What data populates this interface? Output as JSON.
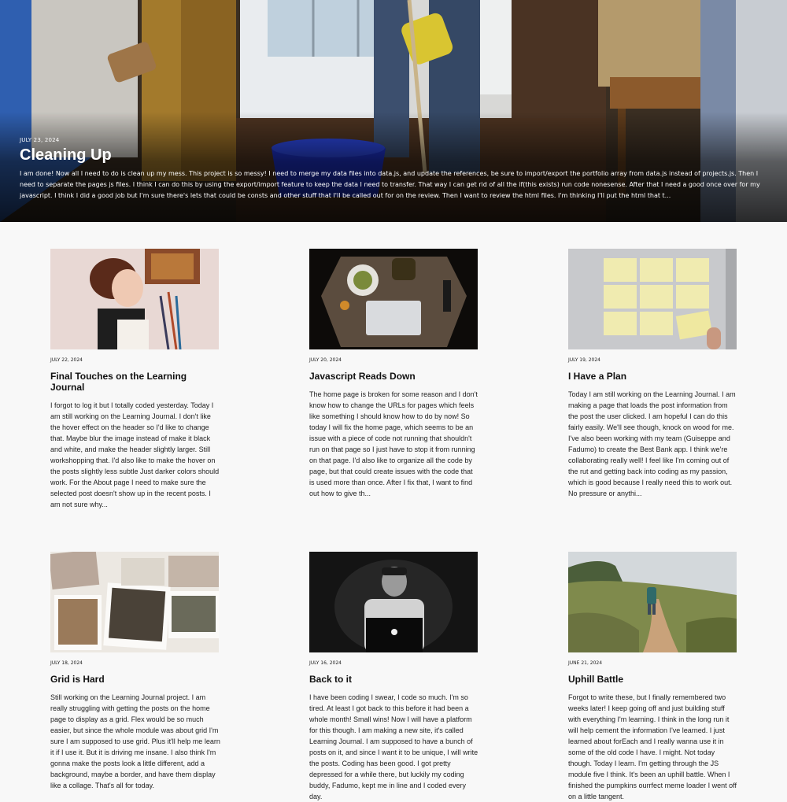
{
  "hero": {
    "date": "JULY 23, 2024",
    "title": "Cleaning Up",
    "excerpt": "I am done! Now all I need to do is clean up my mess. This project is so messy! I need to merge my data files into data.js, and update the references, be sure to import/export the portfolio array from data.js instead of projects.js. Then I need to separate the pages js files. I think I can do this by using the export/import feature to keep the data I need to transfer. That way I can get rid of all the if(this exists) run code nonesense. After that I need a good once over for my javascript. I think I did a good job but I'm sure there's lets that could be consts and other stuff that I'll be called out for on the review. Then I want to review the html files. I'm thinking I'll put the html that t..."
  },
  "posts": [
    {
      "date": "JULY 22, 2024",
      "title": "Final Touches on the Learning Journal",
      "excerpt": "I forgot to log it but I totally coded yesterday. Today I am still working on the Learning Journal. I don't like the hover effect on the header so I'd like to change that. Maybe blur the image instead of make it black and white, and make the header slightly larger. Still workshopping that. I'd also like to make the hover on the posts slightly less subtle Just darker colors should work. For the About page I need to make sure the selected post doesn't show up in the recent posts. I am not sure why..."
    },
    {
      "date": "JULY 20, 2024",
      "title": "Javascript Reads Down",
      "excerpt": "The home page is broken for some reason and I don't know how to change the URLs for pages which feels like something I should know how to do by now! So today I will fix the home page, which seems to be an issue with a piece of code not running that shouldn't run on that page so I just have to stop it from running on that page. I'd also like to organize all the code by page, but that could create issues with the code that is used more than once. After I fix that, I want to find out how to give th..."
    },
    {
      "date": "JULY 19, 2024",
      "title": "I Have a Plan",
      "excerpt": "Today I am still working on the Learning Journal. I am making a page that loads the post information from the post the user clicked. I am hopeful I can do this fairly easily. We'll see though, knock on wood for me. I've also been working with my team (Guiseppe and Fadumo) to create the Best Bank app. I think we're collaborating really well! I feel like I'm coming out of the rut and getting back into coding as my passion, which is good because I really need this to work out. No pressure or anythi..."
    },
    {
      "date": "JULY 18, 2024",
      "title": "Grid is Hard",
      "excerpt": "Still working on the Learning Journal project. I am really struggling with getting the posts on the home page to display as a grid. Flex would be so much easier, but since the whole module was about grid I'm sure I am supposed to use grid. Plus it'll help me learn it if I use it. But it is driving me insane. I also think I'm gonna make the posts look a little different, add a background, maybe a border, and have them display like a collage. That's all for today."
    },
    {
      "date": "JULY 16, 2024",
      "title": "Back to it",
      "excerpt": "I have been coding I swear, I code so much. I'm so tired. At least I got back to this before it had been a whole month! Small wins! Now I will have a platform for this though. I am making a new site, it's called Learning Journal. I am supposed to have a bunch of posts on it, and since I want it to be unique, I will write the posts. Coding has been good. I got pretty depressed for a while there, but luckily my coding buddy, Fadumo, kept me in line and I coded every day."
    },
    {
      "date": "JUNE 21, 2024",
      "title": "Uphill Battle",
      "excerpt": "Forgot to write these, but I finally remembered two weeks later! I keep going off and just building stuff with everything I'm learning. I think in the long run it will help cement the information I've learned. I just learned about forEach and I really wanna use it in some of the old code I have. I might. Not today though. Today I learn. I'm getting through the JS module five I think. It's been an uphill battle. When I finished the pumpkins ourrfect meme loader I went off on a little tangent."
    }
  ]
}
